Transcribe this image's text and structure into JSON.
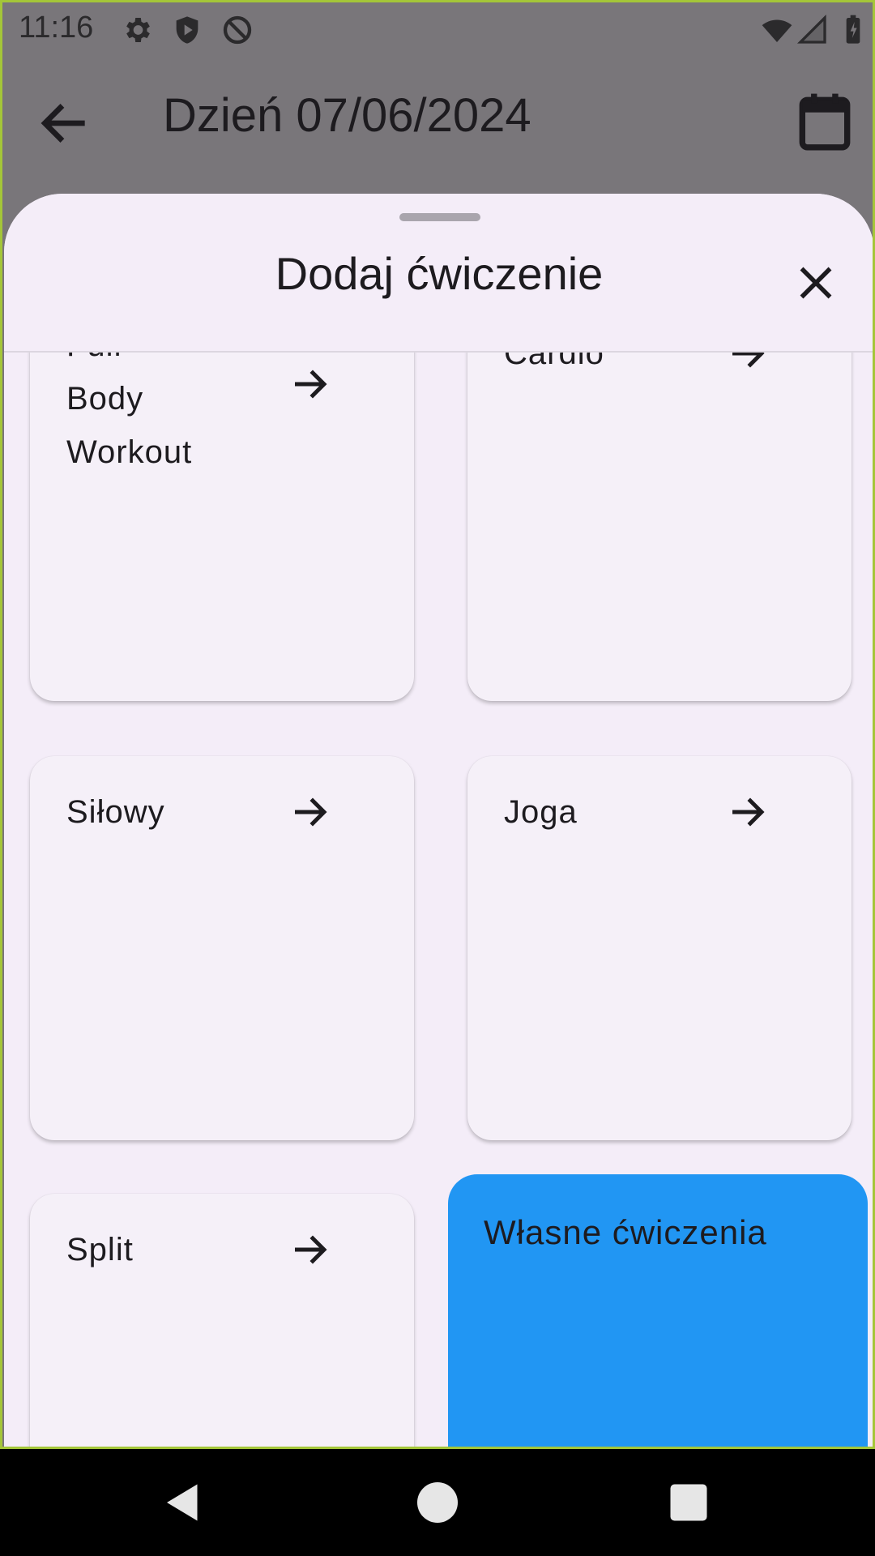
{
  "status_bar": {
    "time": "11:16",
    "icons": [
      "settings-icon",
      "shield-icon",
      "do-not-disturb-icon",
      "wifi-icon",
      "signal-icon",
      "battery-charging-icon"
    ]
  },
  "app_bar": {
    "title": "Dzień 07/06/2024",
    "back_icon": "arrow-back-icon",
    "calendar_icon": "calendar-icon"
  },
  "sheet": {
    "title": "Dodaj ćwiczenie",
    "close_icon": "close-icon",
    "categories": [
      {
        "label": "Full\nBody\nWorkout"
      },
      {
        "label": "Cardio"
      },
      {
        "label": "Siłowy"
      },
      {
        "label": "Joga"
      },
      {
        "label": "Split"
      }
    ],
    "custom": {
      "label": "Własne ćwiczenia"
    }
  },
  "colors": {
    "scrim": "#79767a",
    "sheet_bg": "#f4edf8",
    "card_bg": "#f5f0f8",
    "custom_card": "#2196f3",
    "frame_border": "#a4c639"
  }
}
